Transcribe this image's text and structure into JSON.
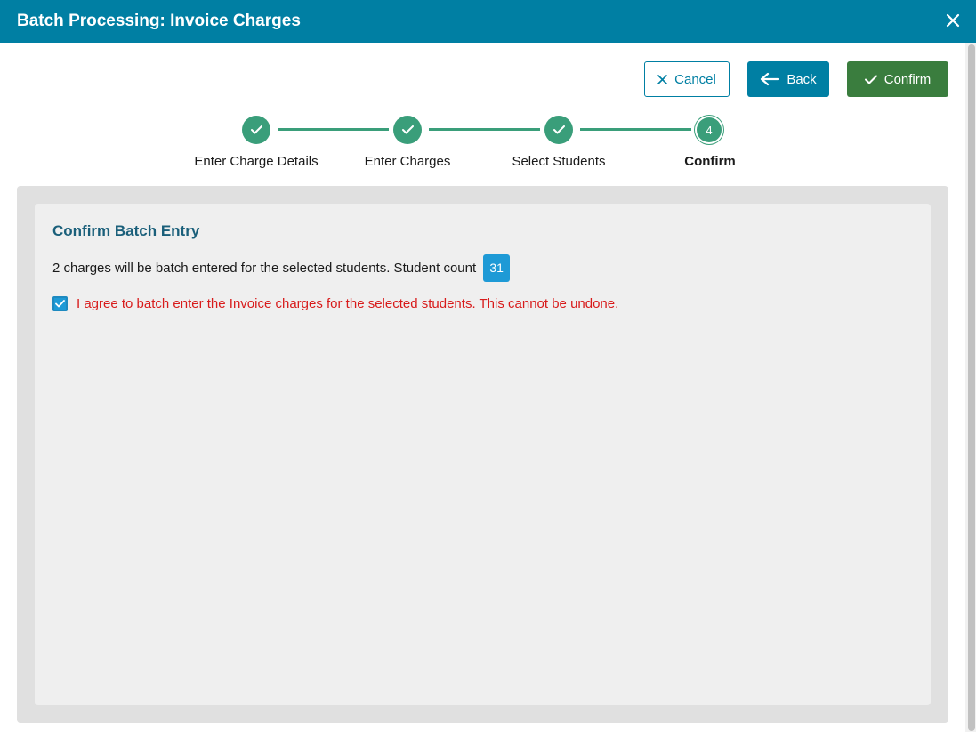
{
  "window": {
    "title": "Batch Processing: Invoice Charges",
    "close_icon": "close-icon"
  },
  "toolbar": {
    "cancel_label": "Cancel",
    "back_label": "Back",
    "confirm_label": "Confirm"
  },
  "stepper": {
    "steps": [
      {
        "label": "Enter Charge Details",
        "state": "complete"
      },
      {
        "label": "Enter Charges",
        "state": "complete"
      },
      {
        "label": "Select Students",
        "state": "complete"
      },
      {
        "label": "Confirm",
        "state": "current",
        "number": "4"
      }
    ]
  },
  "content": {
    "section_title": "Confirm Batch Entry",
    "summary_text": "2 charges will be batch entered for the selected students. Student count",
    "student_count": "31",
    "agree_text": "I agree to batch enter the Invoice charges for the selected students. This cannot be undone.",
    "agree_checked": true
  },
  "colors": {
    "header": "#007fa3",
    "primary": "#007fa3",
    "success": "#3a7d3e",
    "step": "#3a9e7a",
    "badge": "#1e9ad6",
    "warning_text": "#d81b1b"
  }
}
